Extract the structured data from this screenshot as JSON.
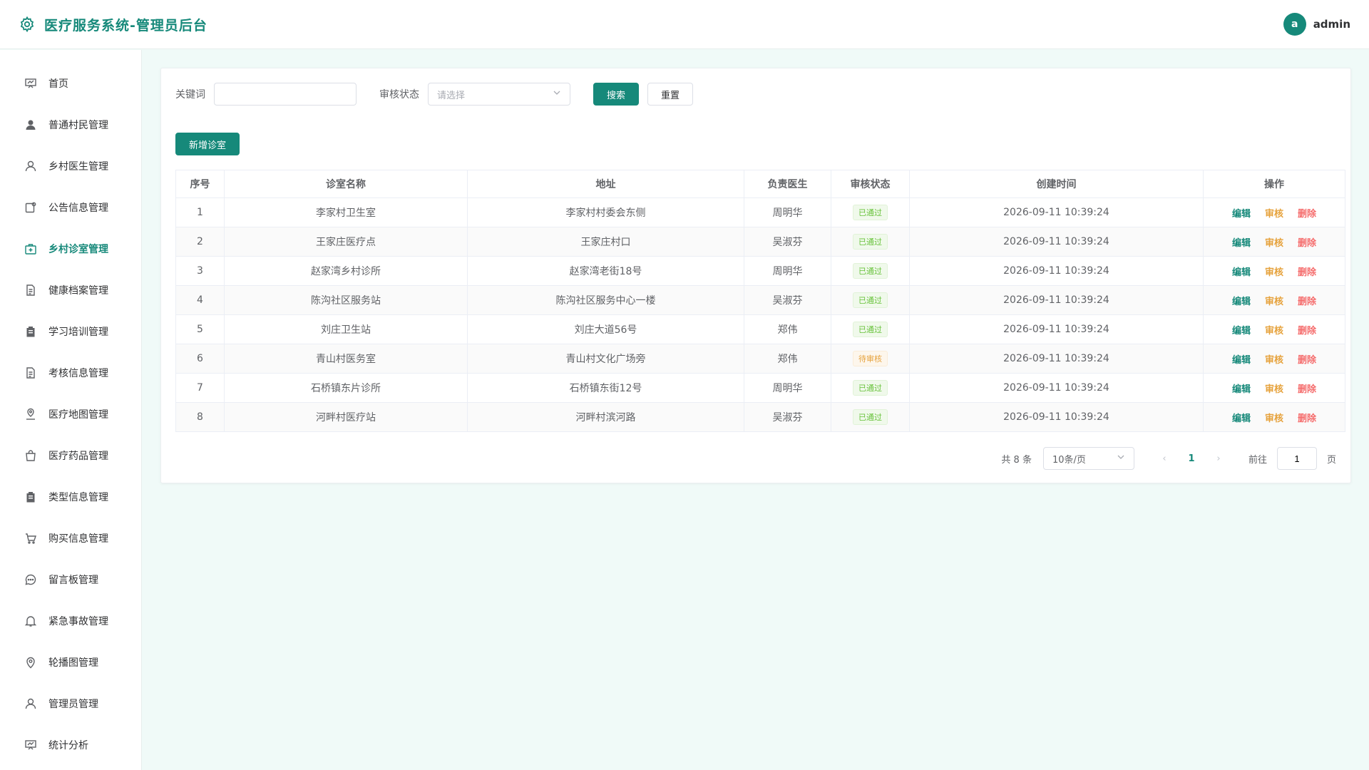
{
  "header": {
    "title": "医疗服务系统-管理员后台",
    "avatar_letter": "a",
    "username": "admin"
  },
  "sidebar": {
    "items": [
      {
        "label": "首页",
        "icon": "dashboard-icon"
      },
      {
        "label": "普通村民管理",
        "icon": "user-filled-icon"
      },
      {
        "label": "乡村医生管理",
        "icon": "user-icon"
      },
      {
        "label": "公告信息管理",
        "icon": "notice-icon"
      },
      {
        "label": "乡村诊室管理",
        "icon": "first-aid-icon",
        "active": true
      },
      {
        "label": "健康档案管理",
        "icon": "document-icon"
      },
      {
        "label": "学习培训管理",
        "icon": "clipboard-icon"
      },
      {
        "label": "考核信息管理",
        "icon": "document-icon"
      },
      {
        "label": "医疗地图管理",
        "icon": "map-location-icon"
      },
      {
        "label": "医疗药品管理",
        "icon": "shopping-bag-icon"
      },
      {
        "label": "类型信息管理",
        "icon": "clipboard-icon"
      },
      {
        "label": "购买信息管理",
        "icon": "cart-icon"
      },
      {
        "label": "留言板管理",
        "icon": "chat-icon"
      },
      {
        "label": "紧急事故管理",
        "icon": "bell-icon"
      },
      {
        "label": "轮播图管理",
        "icon": "location-icon"
      },
      {
        "label": "管理员管理",
        "icon": "user-icon"
      },
      {
        "label": "统计分析",
        "icon": "dashboard-icon"
      }
    ]
  },
  "filter": {
    "keyword_label": "关键词",
    "keyword_value": "",
    "status_label": "审核状态",
    "status_placeholder": "请选择",
    "search_label": "搜索",
    "reset_label": "重置"
  },
  "add_label": "新增诊室",
  "table": {
    "headers": [
      "序号",
      "诊室名称",
      "地址",
      "负责医生",
      "审核状态",
      "创建时间",
      "操作"
    ],
    "rows": [
      {
        "no": "1",
        "name": "李家村卫生室",
        "address": "李家村村委会东侧",
        "doctor": "周明华",
        "status": "已通过",
        "time": "2026-09-11 10:39:24"
      },
      {
        "no": "2",
        "name": "王家庄医疗点",
        "address": "王家庄村口",
        "doctor": "吴淑芬",
        "status": "已通过",
        "time": "2026-09-11 10:39:24"
      },
      {
        "no": "3",
        "name": "赵家湾乡村诊所",
        "address": "赵家湾老街18号",
        "doctor": "周明华",
        "status": "已通过",
        "time": "2026-09-11 10:39:24"
      },
      {
        "no": "4",
        "name": "陈沟社区服务站",
        "address": "陈沟社区服务中心一楼",
        "doctor": "吴淑芬",
        "status": "已通过",
        "time": "2026-09-11 10:39:24"
      },
      {
        "no": "5",
        "name": "刘庄卫生站",
        "address": "刘庄大道56号",
        "doctor": "郑伟",
        "status": "已通过",
        "time": "2026-09-11 10:39:24"
      },
      {
        "no": "6",
        "name": "青山村医务室",
        "address": "青山村文化广场旁",
        "doctor": "郑伟",
        "status": "待审核",
        "time": "2026-09-11 10:39:24"
      },
      {
        "no": "7",
        "name": "石桥镇东片诊所",
        "address": "石桥镇东街12号",
        "doctor": "周明华",
        "status": "已通过",
        "time": "2026-09-11 10:39:24"
      },
      {
        "no": "8",
        "name": "河畔村医疗站",
        "address": "河畔村滨河路",
        "doctor": "吴淑芬",
        "status": "已通过",
        "time": "2026-09-11 10:39:24"
      }
    ],
    "actions": {
      "edit": "编辑",
      "audit": "审核",
      "delete": "删除"
    }
  },
  "pagination": {
    "total_text": "共 8 条",
    "page_size": "10条/页",
    "current_page": "1",
    "goto_label": "前往",
    "goto_value": "1",
    "page_suffix": "页"
  },
  "colors": {
    "primary": "#16897a",
    "success": "#67c23a",
    "warning": "#e6a23c",
    "danger": "#f56c6c"
  }
}
